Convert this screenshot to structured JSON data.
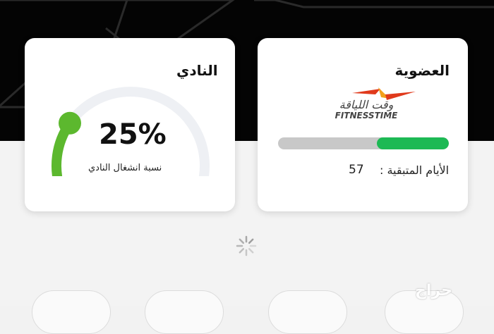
{
  "membership": {
    "title": "العضوية",
    "brand_arabic": "وقت اللياقة",
    "brand_latin": "FITNESSTIME",
    "remaining_fraction": 0.42,
    "days_label": "الأيام المتبقية :",
    "days_value": "57",
    "colors": {
      "track": "#c8c8c8",
      "fill": "#1db954",
      "logo_red": "#e03a1c",
      "logo_orange": "#f2a01c"
    }
  },
  "club": {
    "title": "النادي",
    "occupancy_percent_text": "25%",
    "occupancy_fraction": 0.25,
    "occupancy_label": "نسبة انشغال النادي",
    "colors": {
      "gauge_track": "#eef0f4",
      "gauge_fill": "#5cb82e"
    }
  },
  "watermark": {
    "text": "حراج"
  },
  "icons": {
    "loading": "loading-spinner-icon"
  }
}
